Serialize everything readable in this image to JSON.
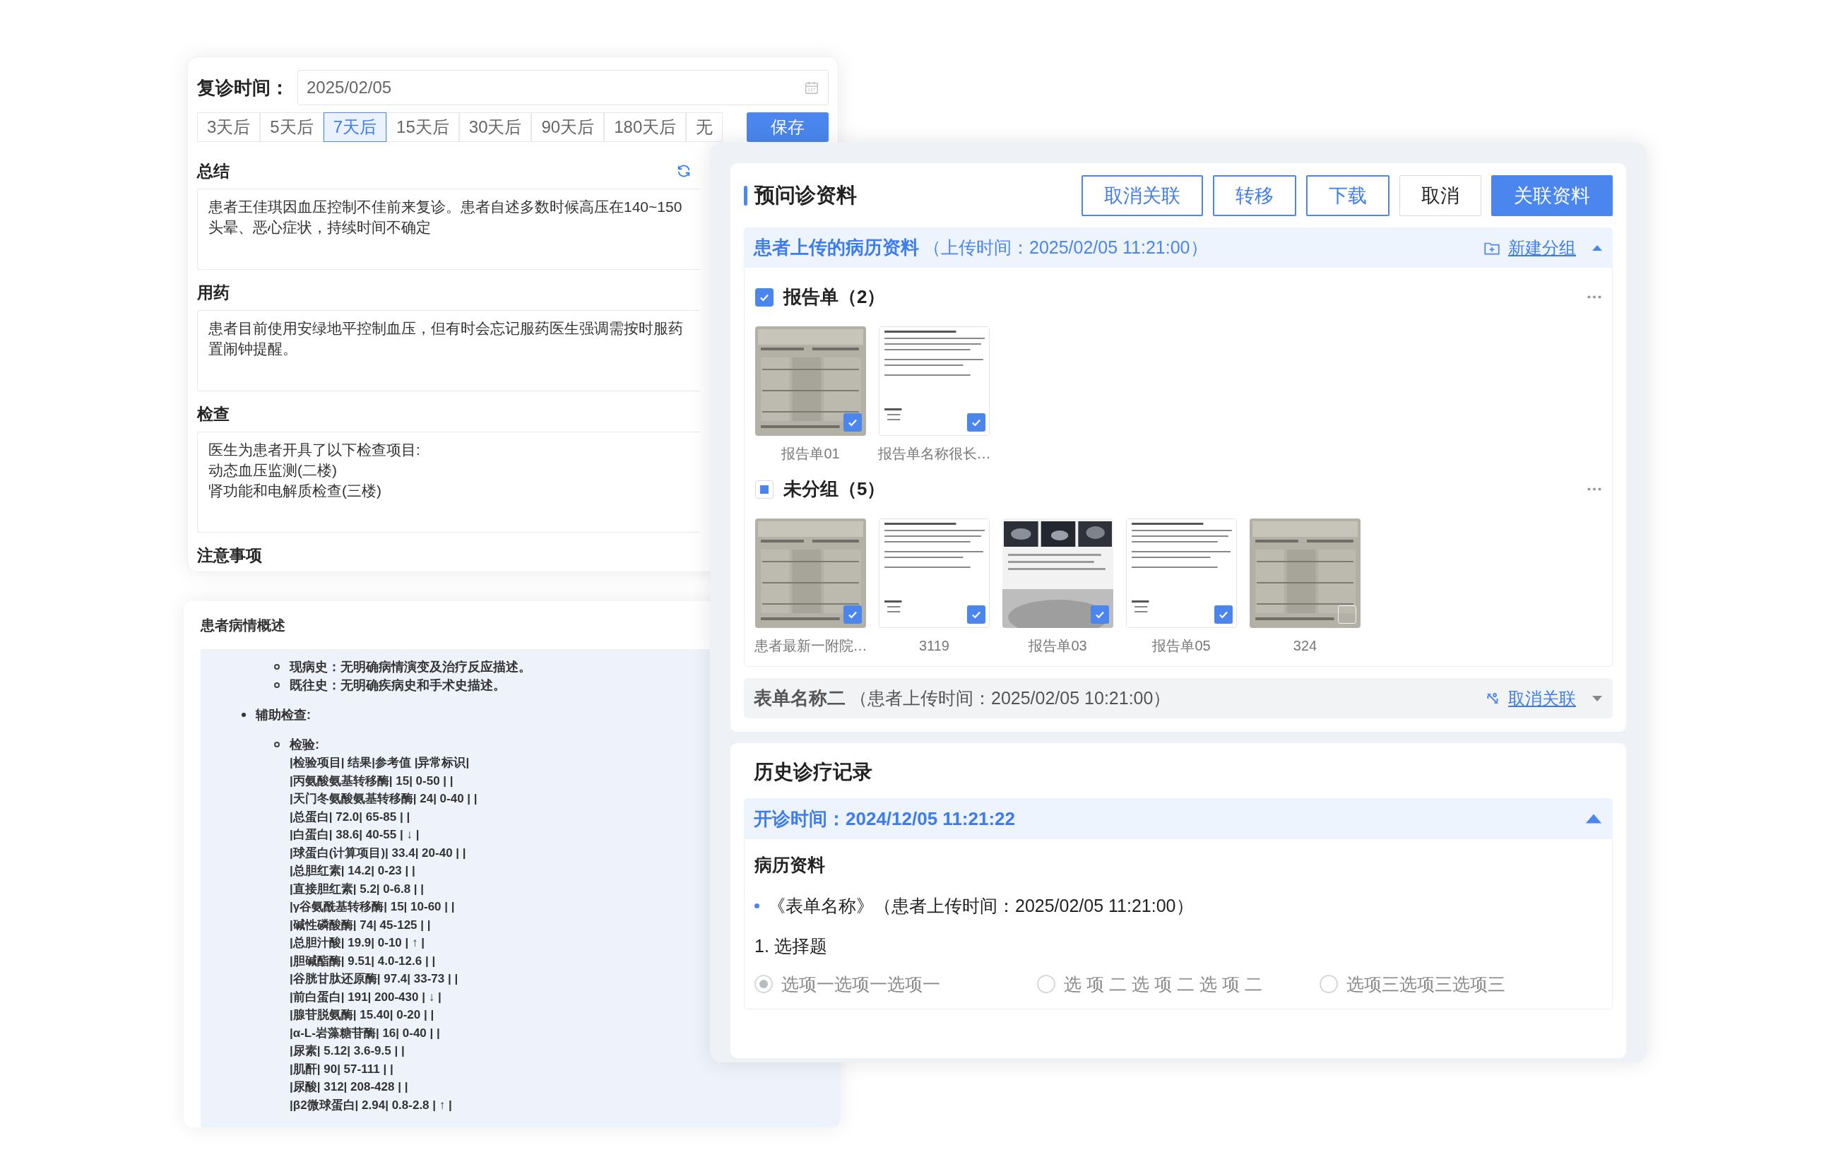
{
  "followup": {
    "label": "复诊时间：",
    "date": "2025/02/05",
    "save": "保存",
    "options": [
      {
        "label": "3天后",
        "selected": false
      },
      {
        "label": "5天后",
        "selected": false
      },
      {
        "label": "7天后",
        "selected": true
      },
      {
        "label": "15天后",
        "selected": false
      },
      {
        "label": "30天后",
        "selected": false
      },
      {
        "label": "90天后",
        "selected": false
      },
      {
        "label": "180天后",
        "selected": false
      },
      {
        "label": "无",
        "selected": false
      }
    ]
  },
  "notes": [
    {
      "title": "总结",
      "refresh": true,
      "lines": [
        "患者王佳琪因血压控制不佳前来复诊。患者自述多数时候高压在140~150",
        "头晕、恶心症状，持续时间不确定"
      ]
    },
    {
      "title": "用药",
      "lines": [
        "患者目前使用安绿地平控制血压，但有时会忘记服药医生强调需按时服药",
        "置闹钟提醒。"
      ]
    },
    {
      "title": "检查",
      "lines": [
        "医生为患者开具了以下检查项目:",
        "动态血压监测(二楼)",
        "肾功能和电解质检查(三楼)"
      ]
    },
    {
      "title": "注意事项"
    }
  ],
  "overview": {
    "title": "患者病情概述",
    "items": [
      {
        "children": [
          {
            "text": "现病史：无明确病情演变及治疗反应描述。"
          },
          {
            "text": "既往史：无明确疾病史和手术史描述。"
          }
        ]
      },
      {
        "text": "辅助检查:",
        "children": [
          {
            "text": "检验:",
            "lines": [
              "|检验项目| 结果|参考值 |异常标识|",
              "|丙氨酸氨基转移酶| 15| 0-50 | |",
              "|天门冬氨酸氨基转移酶| 24| 0-40 | |",
              "|总蛋白| 72.0| 65-85 | |",
              "|白蛋白| 38.6| 40-55 | ↓ |",
              "|球蛋白(计算项目)| 33.4| 20-40 | |",
              "|总胆红素| 14.2| 0-23 | |",
              "|直接胆红素| 5.2| 0-6.8 | |",
              "|γ谷氨酰基转移酶| 15| 10-60 | |",
              "|碱性磷酸酶| 74| 45-125 | |",
              "|总胆汁酸| 19.9| 0-10 | ↑ |",
              "|胆碱酯酶| 9.51| 4.0-12.6 | |",
              "|谷胱甘肽还原酶| 97.4| 33-73 | |",
              "|前白蛋白| 191| 200-430 | ↓ |",
              "|腺苷脱氨酶| 15.40| 0-20 | |",
              "|α-L-岩藻糖苷酶| 16| 0-40 | |",
              "|尿素| 5.12| 3.6-9.5 | |",
              "|肌酐| 90| 57-111 | |",
              "|尿酸| 312| 208-428 | |",
              "|β2微球蛋白| 2.94| 0.8-2.8 | ↑ |"
            ]
          }
        ]
      }
    ]
  },
  "pre_consult": {
    "title": "预问诊资料",
    "buttons": [
      {
        "label": "取消关联",
        "kind": "outline"
      },
      {
        "label": "转移",
        "kind": "outline"
      },
      {
        "label": "下载",
        "kind": "outline"
      },
      {
        "label": "取消",
        "kind": "default"
      },
      {
        "label": "关联资料",
        "kind": "primary"
      }
    ],
    "sections": [
      {
        "title": "患者上传的病历资料",
        "time": "（上传时间：2025/02/05 11:21:00）",
        "expanded": true,
        "action": {
          "kind": "new-group",
          "label": "新建分组"
        },
        "groups": [
          {
            "title": "报告单（2）",
            "checked": true,
            "files": [
              {
                "caption": "报告单01",
                "checked": true
              },
              {
                "caption": "报告单名称很长…",
                "checked": true
              }
            ]
          },
          {
            "title": "未分组（5）",
            "checked": false,
            "indeterminate": true,
            "files": [
              {
                "caption": "患者最新一附院…",
                "checked": true
              },
              {
                "caption": "3119",
                "checked": true
              },
              {
                "caption": "报告单03",
                "checked": true
              },
              {
                "caption": "报告单05",
                "checked": true
              },
              {
                "caption": "324",
                "checked": false
              }
            ]
          }
        ]
      },
      {
        "title": "表单名称二",
        "time": "（患者上传时间：2025/02/05 10:21:00）",
        "expanded": false,
        "action": {
          "kind": "unlink",
          "label": "取消关联"
        }
      }
    ]
  },
  "history": {
    "title": "历史诊疗记录",
    "records": [
      {
        "title": "开诊时间：2024/12/05 11:21:22",
        "expanded": true,
        "heading": "病历资料",
        "forms": [
          "《表单名称》（患者上传时间：2025/02/05 11:21:00）"
        ],
        "question": "1. 选择题",
        "options": [
          {
            "label": "选项一选项一选项一",
            "selected": true
          },
          {
            "label": "选 项 二 选 项 二 选 项 二",
            "selected": false
          },
          {
            "label": "选项三选项三选项三",
            "selected": false
          }
        ]
      }
    ]
  }
}
